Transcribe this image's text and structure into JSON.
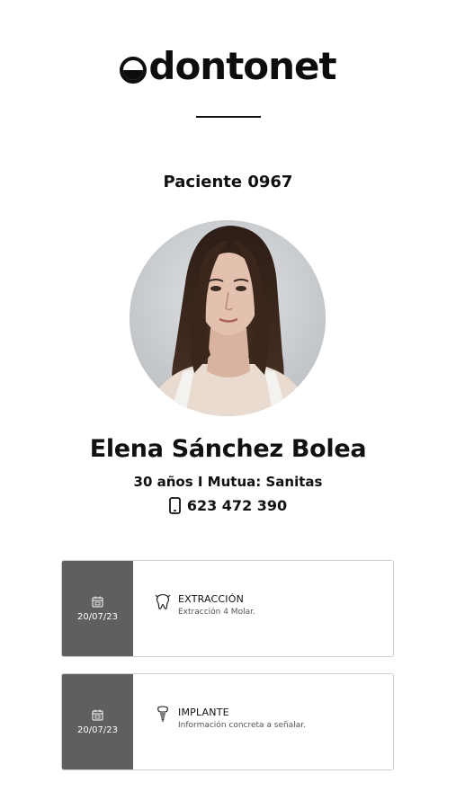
{
  "app": {
    "logo_text": "dontonet"
  },
  "patient": {
    "id_label": "Paciente 0967",
    "name": "Elena Sánchez Bolea",
    "meta": "30 años I Mutua: Sanitas",
    "phone": "623 472 390"
  },
  "treatments": [
    {
      "date": "20/07/23",
      "title": "EXTRACCIÓN",
      "description": "Extracción 4 Molar.",
      "icon": "tooth-icon"
    },
    {
      "date": "20/07/23",
      "title": "IMPLANTE",
      "description": "Información concreta a señalar.",
      "icon": "implant-icon"
    }
  ],
  "colors": {
    "date_panel": "#5f5f5f",
    "card_border": "#cfcfcf",
    "text": "#111111"
  }
}
